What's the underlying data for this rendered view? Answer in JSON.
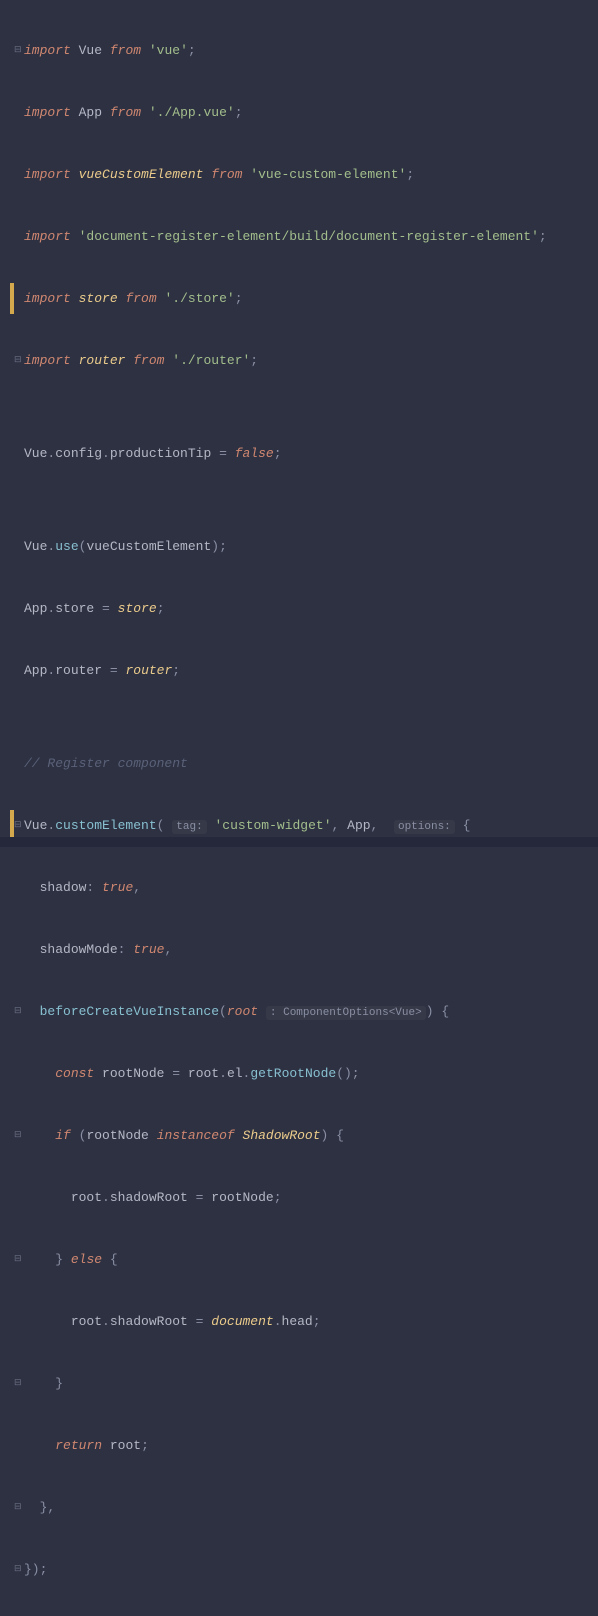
{
  "lines": {
    "l1_import": "import",
    "l1_vue": "Vue",
    "l1_from": "from",
    "l1_str": "'vue'",
    "l2_import": "import",
    "l2_app": "App",
    "l2_from": "from",
    "l2_str": "'./App.vue'",
    "l3_import": "import",
    "l3_vce": "vueCustomElement",
    "l3_from": "from",
    "l3_str": "'vue-custom-element'",
    "l4_import": "import",
    "l4_str": "'document-register-element/build/document-register-element'",
    "l5_import": "import",
    "l5_store": "store",
    "l5_from": "from",
    "l5_str": "'./store'",
    "l6_import": "import",
    "l6_router": "router",
    "l6_from": "from",
    "l6_str": "'./router'",
    "l7_vue": "Vue",
    "l7_config": "config",
    "l7_prod": "productionTip",
    "l7_false": "false",
    "l8_vue": "Vue",
    "l8_use": "use",
    "l8_arg": "vueCustomElement",
    "l9_app": "App",
    "l9_store": "store",
    "l9_store2": "store",
    "l10_app": "App",
    "l10_router": "router",
    "l10_router2": "router",
    "l11_cmt": "// Register component",
    "l12_vue": "Vue",
    "l12_ce": "customElement",
    "l12_tag": "tag:",
    "l12_str": "'custom-widget'",
    "l12_app": "App",
    "l12_opts": "options:",
    "l13_shadow": "shadow",
    "l13_true": "true",
    "l14_sm": "shadowMode",
    "l14_true": "true",
    "l15_bci": "beforeCreateVueInstance",
    "l15_root": "root",
    "l15_type": ": ComponentOptions<Vue>",
    "l16_const": "const",
    "l16_rn": "rootNode",
    "l16_root": "root",
    "l16_el": "el",
    "l16_grn": "getRootNode",
    "l17_if": "if",
    "l17_rn": "rootNode",
    "l17_inst": "instanceof",
    "l17_sr": "ShadowRoot",
    "l18_root": "root",
    "l18_sr": "shadowRoot",
    "l18_rn": "rootNode",
    "l19_else": "else",
    "l20_root": "root",
    "l20_sr": "shadowRoot",
    "l20_doc": "document",
    "l20_head": "head",
    "l21_return": "return",
    "l21_root": "root"
  }
}
